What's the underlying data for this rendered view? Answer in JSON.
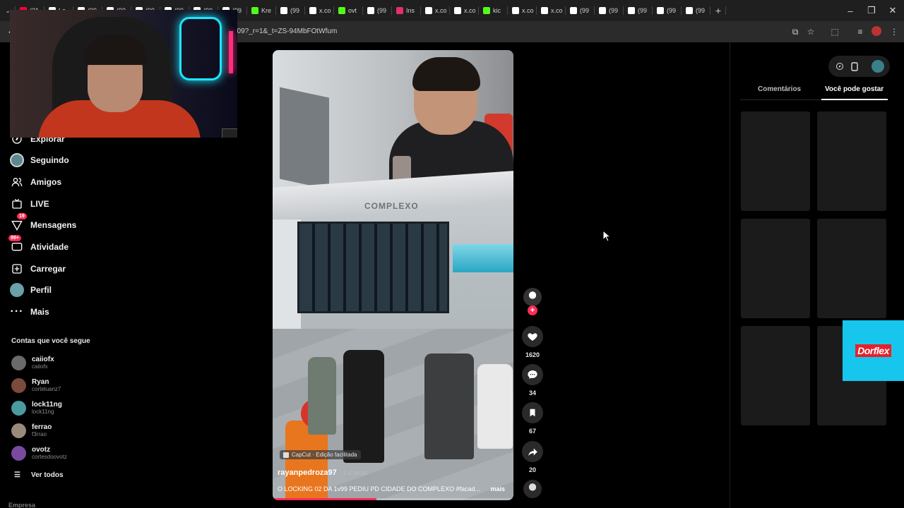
{
  "browser": {
    "tabs": [
      {
        "label": "(31",
        "color": "#ff0033"
      },
      {
        "label": "Le",
        "color": "#ffffff"
      },
      {
        "label": "(99",
        "color": "#ffffff"
      },
      {
        "label": "(99",
        "color": "#ffffff"
      },
      {
        "label": "(99",
        "color": "#ffffff"
      },
      {
        "label": "(99",
        "color": "#ffffff"
      },
      {
        "label": "(99",
        "color": "#ffffff"
      },
      {
        "label": "(99",
        "color": "#ffffff"
      },
      {
        "label": "Kre",
        "color": "#53fc18"
      },
      {
        "label": "(99",
        "color": "#ffffff"
      },
      {
        "label": "x.co",
        "color": "#ffffff"
      },
      {
        "label": "ovt",
        "color": "#53fc18"
      },
      {
        "label": "(99",
        "color": "#ffffff"
      },
      {
        "label": "Ins",
        "color": "#e1306c"
      },
      {
        "label": "x.co",
        "color": "#ffffff"
      },
      {
        "label": "x.co",
        "color": "#ffffff"
      },
      {
        "label": "kic",
        "color": "#53fc18"
      },
      {
        "label": "x.co",
        "color": "#ffffff"
      },
      {
        "label": "x.co",
        "color": "#ffffff"
      },
      {
        "label": "(99",
        "color": "#ffffff"
      },
      {
        "label": "(99",
        "color": "#ffffff"
      },
      {
        "label": "(99",
        "color": "#ffffff"
      },
      {
        "label": "(99",
        "color": "#ffffff"
      },
      {
        "label": "(99",
        "color": "#ffffff"
      }
    ],
    "new_tab_icon": "plus-icon",
    "url": "509?_r=1&_t=ZS-94MbFOtWfum"
  },
  "sidebar": {
    "items": [
      {
        "label": "Explorar",
        "icon": "compass-icon"
      },
      {
        "label": "Seguindo",
        "icon": "avatar-icon"
      },
      {
        "label": "Amigos",
        "icon": "friends-icon"
      },
      {
        "label": "LIVE",
        "icon": "live-icon"
      },
      {
        "label": "Mensagens",
        "icon": "message-icon",
        "badge": "19"
      },
      {
        "label": "Atividade",
        "icon": "activity-icon",
        "badge": "99+"
      },
      {
        "label": "Carregar",
        "icon": "upload-icon"
      },
      {
        "label": "Perfil",
        "icon": "profile-icon"
      },
      {
        "label": "Mais",
        "icon": "more-icon"
      }
    ],
    "following_title": "Contas que você segue",
    "accounts": [
      {
        "name": "caiiofx",
        "handle": "caiiofx",
        "color": "#6a6a6a"
      },
      {
        "name": "Ryan",
        "handle": "corteluanz7",
        "color": "#7a4a3a"
      },
      {
        "name": "lock11ng",
        "handle": "lock11ng",
        "color": "#4a9aa0"
      },
      {
        "name": "ferrao",
        "handle": "f3rrao",
        "color": "#9a8a7a"
      },
      {
        "name": "ovotz",
        "handle": "cortesdoovotz",
        "color": "#7a4aa0"
      }
    ],
    "see_all": "Ver todos",
    "footer": "Empresa"
  },
  "video": {
    "roof_sign": "COMPLEXO",
    "tag": "CapCut · Edição facilitada",
    "username": "rayanpedroza97",
    "time": "· 2 d atrás",
    "caption": "O LOCKING 02 DA 1v99 PEDIU PD CIDADE DO COMPLEXO #facad...",
    "more": "mais",
    "progress": 0.43
  },
  "actions": {
    "likes": "1620",
    "comments": "34",
    "saves": "67",
    "shares": "20"
  },
  "right_panel": {
    "tab_comments": "Comentários",
    "tab_like": "Você pode gostar",
    "ad_text": "Dorflex"
  },
  "colors": {
    "accent": "#fe2c55",
    "ad_bg": "#16c6ec"
  }
}
